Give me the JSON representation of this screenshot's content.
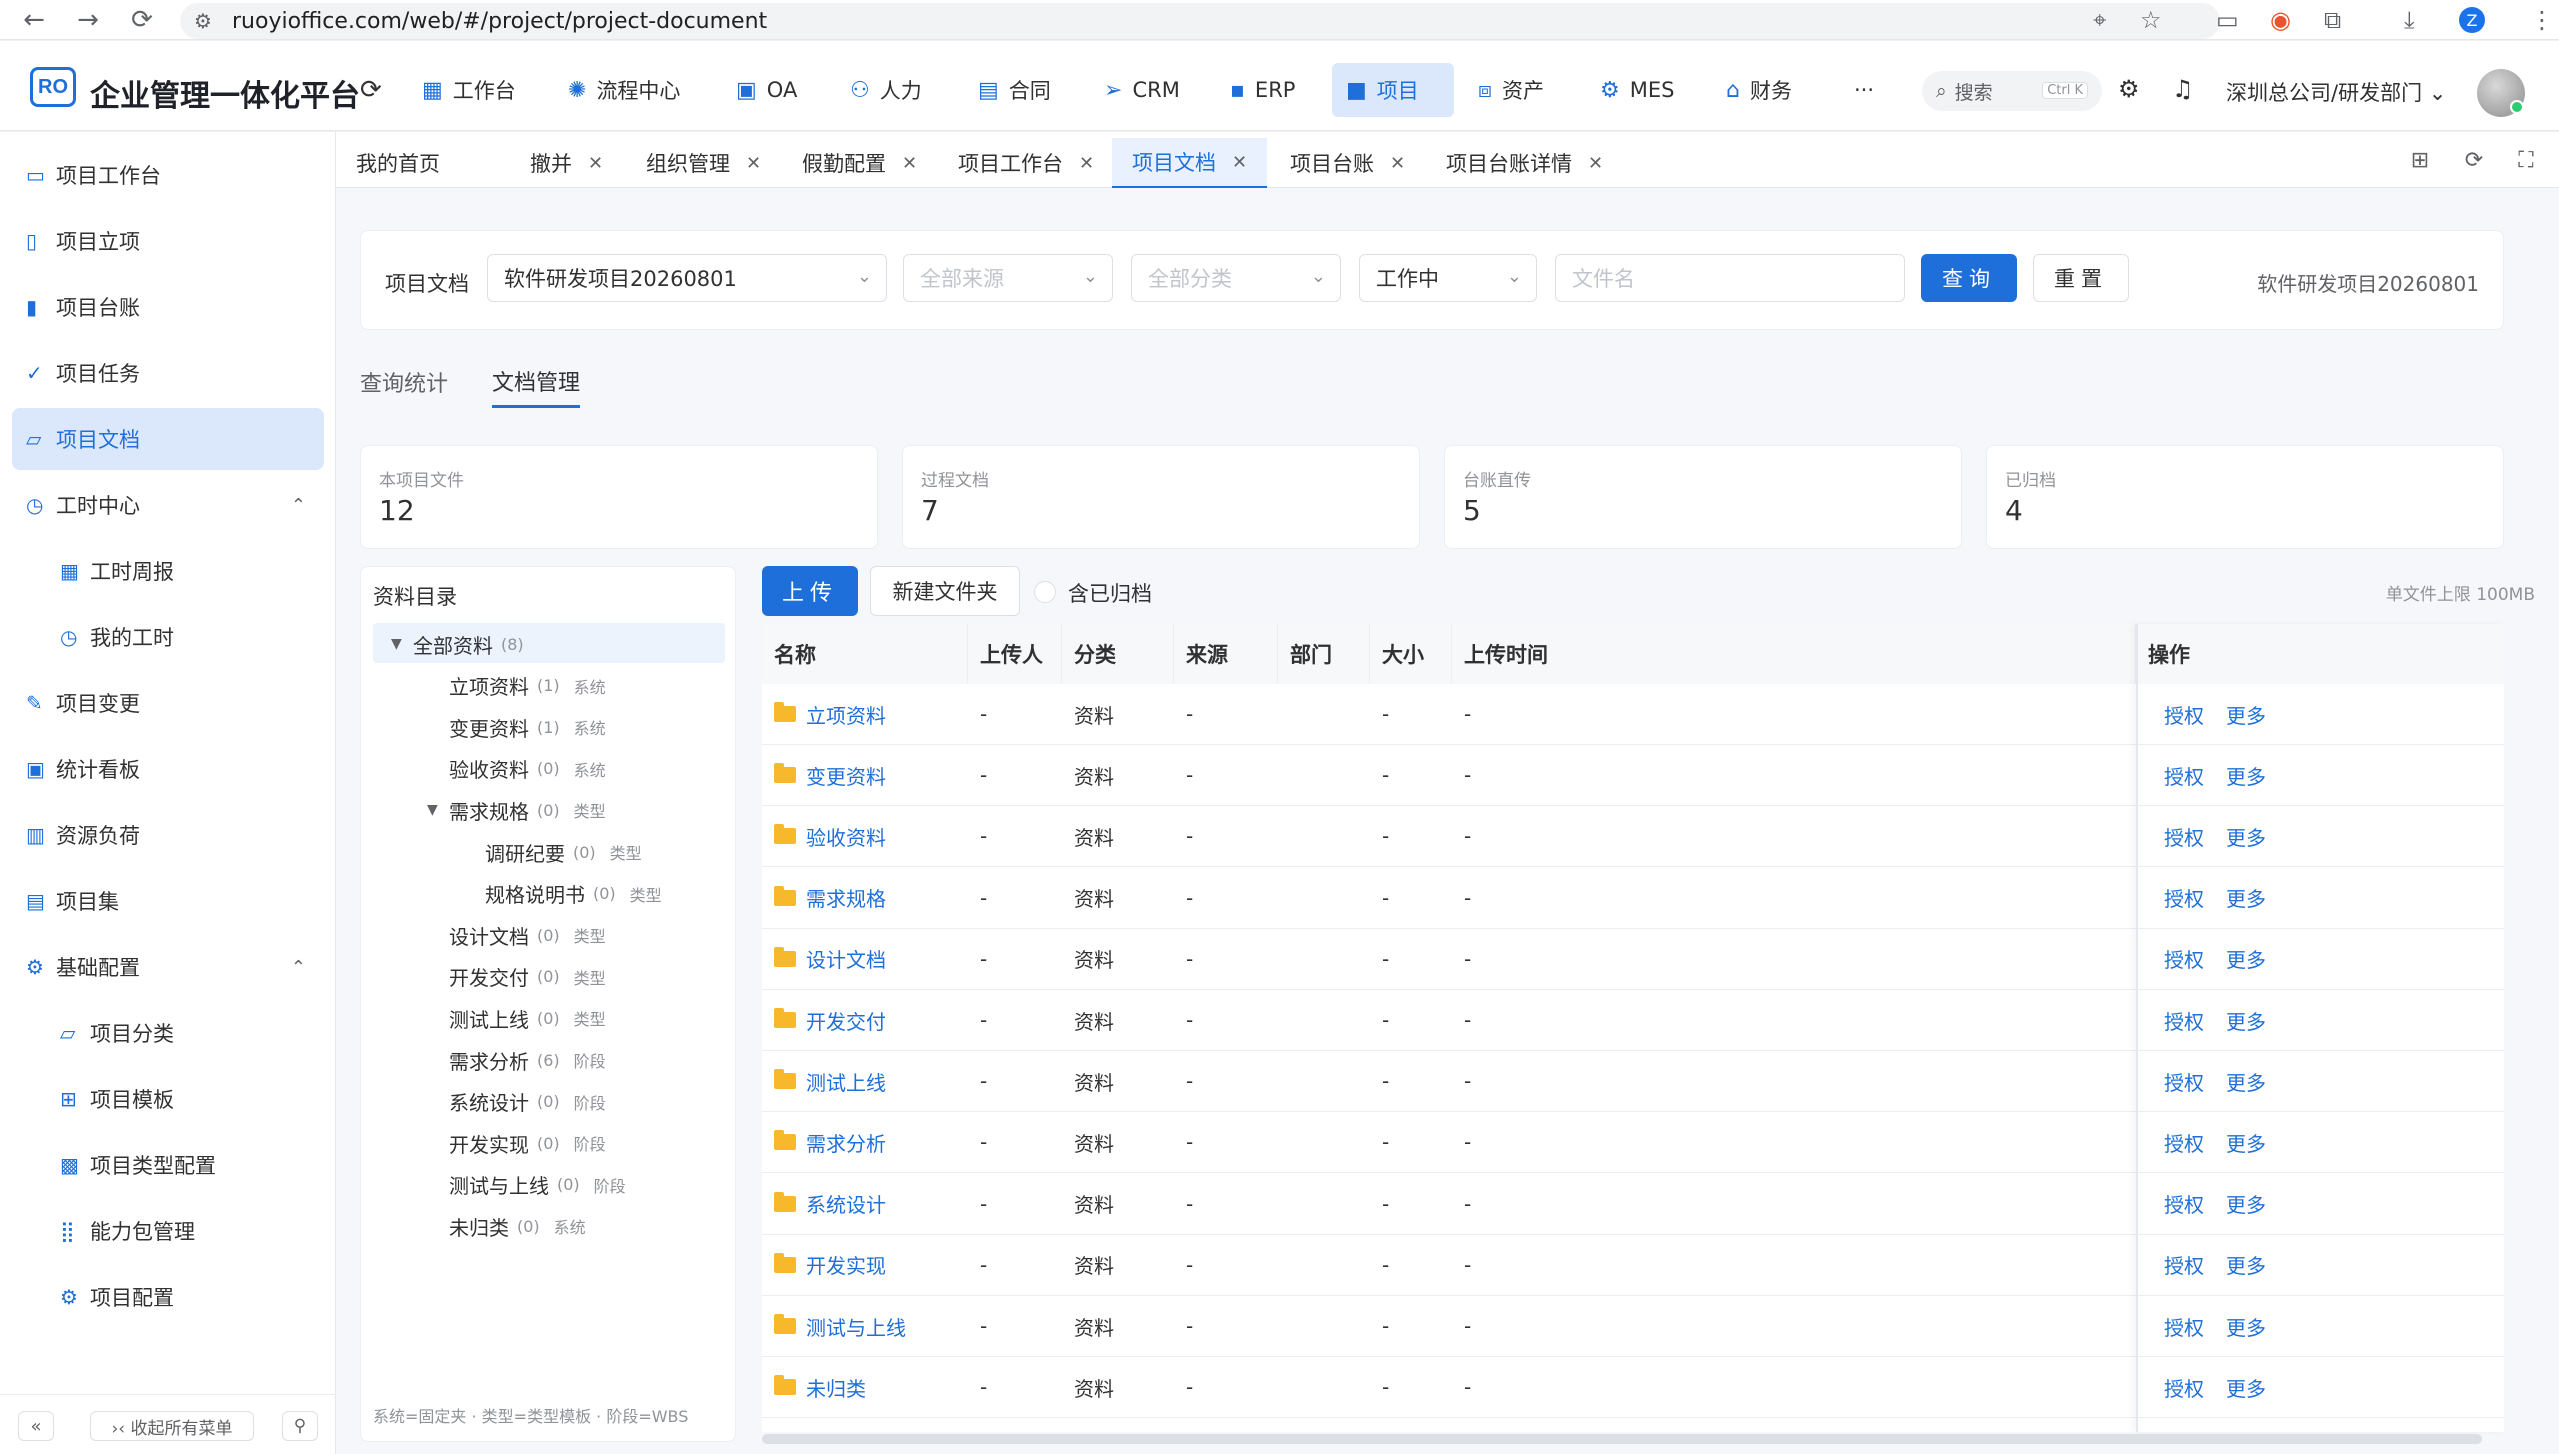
{
  "browser": {
    "url": "ruoyioffice.com/web/#/project/project-document",
    "profile_initial": "Z"
  },
  "header": {
    "logo": "RO",
    "title": "企业管理一体化平台",
    "modules": [
      {
        "label": "工作台",
        "icon": "grid-icon"
      },
      {
        "label": "流程中心",
        "icon": "flow-icon"
      },
      {
        "label": "OA",
        "icon": "monitor-icon"
      },
      {
        "label": "人力",
        "icon": "person-icon"
      },
      {
        "label": "合同",
        "icon": "document-icon"
      },
      {
        "label": "CRM",
        "icon": "send-icon"
      },
      {
        "label": "ERP",
        "icon": "erp-icon"
      },
      {
        "label": "项目",
        "icon": "briefcase-icon",
        "active": true
      },
      {
        "label": "资产",
        "icon": "box-icon"
      },
      {
        "label": "MES",
        "icon": "gear-icon"
      },
      {
        "label": "财务",
        "icon": "bank-icon"
      }
    ],
    "more": "···",
    "search_placeholder": "搜索",
    "search_shortcut": "Ctrl K",
    "org": "深圳总公司/研发部门"
  },
  "sidebar": {
    "items": [
      {
        "label": "项目工作台",
        "icon": "monitor-icon"
      },
      {
        "label": "项目立项",
        "icon": "file-add-icon"
      },
      {
        "label": "项目台账",
        "icon": "ledger-icon"
      },
      {
        "label": "项目任务",
        "icon": "task-icon"
      },
      {
        "label": "项目文档",
        "icon": "folder-icon",
        "active": true
      },
      {
        "label": "工时中心",
        "icon": "clock-icon",
        "expanded": true
      },
      {
        "label": "工时周报",
        "icon": "calendar-icon",
        "sub": true
      },
      {
        "label": "我的工时",
        "icon": "clock-icon",
        "sub": true
      },
      {
        "label": "项目变更",
        "icon": "edit-icon"
      },
      {
        "label": "统计看板",
        "icon": "board-icon"
      },
      {
        "label": "资源负荷",
        "icon": "bar-chart-icon"
      },
      {
        "label": "项目集",
        "icon": "collection-icon"
      },
      {
        "label": "基础配置",
        "icon": "settings-icon",
        "expanded": true
      },
      {
        "label": "项目分类",
        "icon": "folder-icon",
        "sub": true
      },
      {
        "label": "项目模板",
        "icon": "template-icon",
        "sub": true
      },
      {
        "label": "项目类型配置",
        "icon": "type-icon",
        "sub": true
      },
      {
        "label": "能力包管理",
        "icon": "apps-icon",
        "sub": true
      },
      {
        "label": "项目配置",
        "icon": "gear-icon",
        "sub": true
      }
    ],
    "collapse_all": "›‹ 收起所有菜单"
  },
  "tabs": [
    {
      "label": "我的首页",
      "closable": false
    },
    {
      "label": "撤并",
      "closable": true
    },
    {
      "label": "组织管理",
      "closable": true
    },
    {
      "label": "假勤配置",
      "closable": true
    },
    {
      "label": "项目工作台",
      "closable": true
    },
    {
      "label": "项目文档",
      "closable": true,
      "active": true
    },
    {
      "label": "项目台账",
      "closable": true
    },
    {
      "label": "项目台账详情",
      "closable": true
    }
  ],
  "filter": {
    "label": "项目文档",
    "project_value": "软件研发项目20260801",
    "source_placeholder": "全部来源",
    "category_placeholder": "全部分类",
    "status_value": "工作中",
    "filename_placeholder": "文件名",
    "query_label": "查询",
    "reset_label": "重置",
    "project_name": "软件研发项目20260801"
  },
  "sub_tabs": [
    {
      "label": "查询统计"
    },
    {
      "label": "文档管理",
      "active": true
    }
  ],
  "stats": [
    {
      "label": "本项目文件",
      "value": "12"
    },
    {
      "label": "过程文档",
      "value": "7"
    },
    {
      "label": "台账直传",
      "value": "5"
    },
    {
      "label": "已归档",
      "value": "4"
    }
  ],
  "tree": {
    "title": "资料目录",
    "nodes": [
      {
        "label": "全部资料",
        "count": "(8)",
        "tag": "",
        "level": 0,
        "caret": true
      },
      {
        "label": "立项资料",
        "count": "(1)",
        "tag": "系统",
        "level": 1
      },
      {
        "label": "变更资料",
        "count": "(1)",
        "tag": "系统",
        "level": 1
      },
      {
        "label": "验收资料",
        "count": "(0)",
        "tag": "系统",
        "level": 1
      },
      {
        "label": "需求规格",
        "count": "(0)",
        "tag": "类型",
        "level": 1,
        "caret": true
      },
      {
        "label": "调研纪要",
        "count": "(0)",
        "tag": "类型",
        "level": 2
      },
      {
        "label": "规格说明书",
        "count": "(0)",
        "tag": "类型",
        "level": 2
      },
      {
        "label": "设计文档",
        "count": "(0)",
        "tag": "类型",
        "level": 1
      },
      {
        "label": "开发交付",
        "count": "(0)",
        "tag": "类型",
        "level": 1
      },
      {
        "label": "测试上线",
        "count": "(0)",
        "tag": "类型",
        "level": 1
      },
      {
        "label": "需求分析",
        "count": "(6)",
        "tag": "阶段",
        "level": 1
      },
      {
        "label": "系统设计",
        "count": "(0)",
        "tag": "阶段",
        "level": 1
      },
      {
        "label": "开发实现",
        "count": "(0)",
        "tag": "阶段",
        "level": 1
      },
      {
        "label": "测试与上线",
        "count": "(0)",
        "tag": "阶段",
        "level": 1
      },
      {
        "label": "未归类",
        "count": "(0)",
        "tag": "系统",
        "level": 1
      }
    ],
    "legend": "系统=固定夹 · 类型=类型模板 · 阶段=WBS"
  },
  "toolbar": {
    "upload_label": "上传",
    "new_folder_label": "新建文件夹",
    "archived_label": "含已归档",
    "limit_text": "单文件上限 100MB"
  },
  "table": {
    "columns": [
      "名称",
      "上传人",
      "分类",
      "来源",
      "部门",
      "大小",
      "上传时间",
      "操作"
    ],
    "rows": [
      {
        "name": "立项资料",
        "uploader": "-",
        "category": "资料",
        "source": "-",
        "dept": "",
        "size": "-",
        "time": "-"
      },
      {
        "name": "变更资料",
        "uploader": "-",
        "category": "资料",
        "source": "-",
        "dept": "",
        "size": "-",
        "time": "-"
      },
      {
        "name": "验收资料",
        "uploader": "-",
        "category": "资料",
        "source": "-",
        "dept": "",
        "size": "-",
        "time": "-"
      },
      {
        "name": "需求规格",
        "uploader": "-",
        "category": "资料",
        "source": "-",
        "dept": "",
        "size": "-",
        "time": "-"
      },
      {
        "name": "设计文档",
        "uploader": "-",
        "category": "资料",
        "source": "-",
        "dept": "",
        "size": "-",
        "time": "-"
      },
      {
        "name": "开发交付",
        "uploader": "-",
        "category": "资料",
        "source": "-",
        "dept": "",
        "size": "-",
        "time": "-"
      },
      {
        "name": "测试上线",
        "uploader": "-",
        "category": "资料",
        "source": "-",
        "dept": "",
        "size": "-",
        "time": "-"
      },
      {
        "name": "需求分析",
        "uploader": "-",
        "category": "资料",
        "source": "-",
        "dept": "",
        "size": "-",
        "time": "-"
      },
      {
        "name": "系统设计",
        "uploader": "-",
        "category": "资料",
        "source": "-",
        "dept": "",
        "size": "-",
        "time": "-"
      },
      {
        "name": "开发实现",
        "uploader": "-",
        "category": "资料",
        "source": "-",
        "dept": "",
        "size": "-",
        "time": "-"
      },
      {
        "name": "测试与上线",
        "uploader": "-",
        "category": "资料",
        "source": "-",
        "dept": "",
        "size": "-",
        "time": "-"
      },
      {
        "name": "未归类",
        "uploader": "-",
        "category": "资料",
        "source": "-",
        "dept": "",
        "size": "-",
        "time": "-"
      }
    ],
    "action_authorize": "授权",
    "action_more": "更多"
  },
  "colors": {
    "primary": "#1e6fd9",
    "folder": "#f7b92b",
    "active_bg": "#dbe8fb"
  }
}
